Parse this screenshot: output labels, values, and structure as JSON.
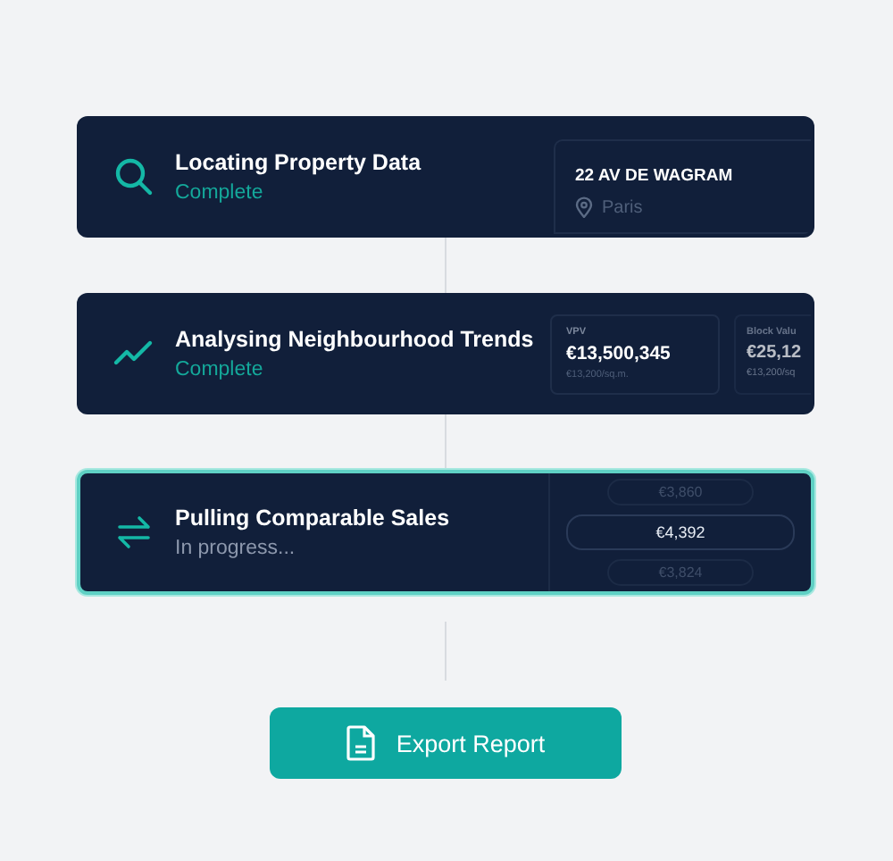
{
  "steps": [
    {
      "kind": "search",
      "title": "Locating Property Data",
      "status": "Complete",
      "done": true,
      "active": false,
      "detail": {
        "kind": "address",
        "address": "22 AV DE WAGRAM",
        "city": "Paris"
      }
    },
    {
      "kind": "trend",
      "title": "Analysing Neighbourhood Trends",
      "status": "Complete",
      "done": true,
      "active": false,
      "detail": {
        "kind": "metrics",
        "metrics": [
          {
            "label": "VPV",
            "value": "€13,500,345",
            "sub": "€13,200/sq.m.",
            "faded": false
          },
          {
            "label": "Block Valu",
            "value": "€25,12",
            "sub": "€13,200/sq",
            "faded": true
          }
        ]
      }
    },
    {
      "kind": "swap",
      "title": "Pulling Comparable Sales",
      "status": "In progress...",
      "done": false,
      "active": true,
      "detail": {
        "kind": "prices",
        "prices": [
          {
            "text": "€3,860",
            "selected": false
          },
          {
            "text": "€4,392",
            "selected": true
          },
          {
            "text": "€3,824",
            "selected": false
          }
        ]
      }
    }
  ],
  "export_button": {
    "label": "Export Report"
  }
}
